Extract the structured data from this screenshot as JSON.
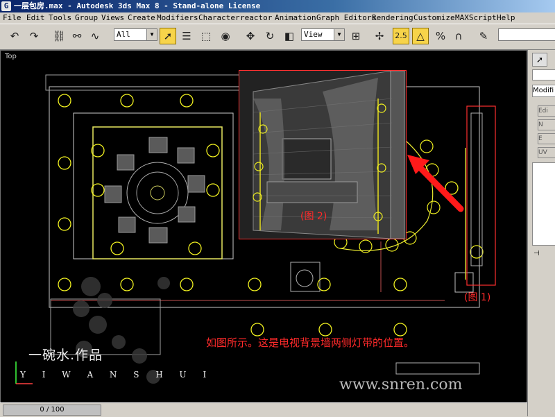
{
  "window": {
    "title": "一层包房.max - Autodesk 3ds Max 8  - Stand-alone License"
  },
  "menu": [
    "File",
    "Edit",
    "Tools",
    "Group",
    "Views",
    "Create",
    "Modifiers",
    "Character",
    "reactor",
    "Animation",
    "Graph Editors",
    "Rendering",
    "Customize",
    "MAXScript",
    "Help"
  ],
  "toolbar": {
    "selection_filter": "All",
    "ref_coord": "View",
    "snap_label": "2.5"
  },
  "viewport": {
    "label": "Top"
  },
  "annotations": {
    "caption": "如图所示。这是电视背景墙两侧灯带的位置。",
    "fig1": "(图 1)",
    "fig2": "(图 2)"
  },
  "signature": {
    "title": "一碗水.作品",
    "pinyin": "Y I   W A N   S H U I"
  },
  "watermark": "www.snren.com",
  "command_panel": {
    "modify_label": "Modifi",
    "buttons": [
      "Edi",
      "N",
      "E",
      "UV"
    ]
  },
  "statusbar": {
    "time": "0 / 100"
  }
}
